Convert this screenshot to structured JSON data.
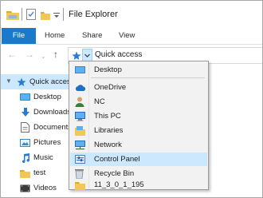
{
  "window": {
    "title": "File Explorer"
  },
  "ribbon": {
    "tabs": [
      "File",
      "Home",
      "Share",
      "View"
    ]
  },
  "address": {
    "path": "Quick access"
  },
  "nav_pane": {
    "quick_access_label": "Quick access",
    "items": [
      {
        "label": "Desktop",
        "icon": "desktop-icon"
      },
      {
        "label": "Downloads",
        "icon": "downloads-icon"
      },
      {
        "label": "Documents",
        "icon": "documents-icon"
      },
      {
        "label": "Pictures",
        "icon": "pictures-icon"
      },
      {
        "label": "Music",
        "icon": "music-icon"
      },
      {
        "label": "test",
        "icon": "folder-icon"
      },
      {
        "label": "Videos",
        "icon": "videos-icon"
      }
    ]
  },
  "dropdown": {
    "items": [
      {
        "label": "Desktop",
        "icon": "desktop-icon"
      },
      {
        "label": "OneDrive",
        "icon": "onedrive-icon"
      },
      {
        "label": "NC",
        "icon": "user-icon"
      },
      {
        "label": "This PC",
        "icon": "this-pc-icon"
      },
      {
        "label": "Libraries",
        "icon": "libraries-icon"
      },
      {
        "label": "Network",
        "icon": "network-icon"
      },
      {
        "label": "Control Panel",
        "icon": "control-panel-icon"
      },
      {
        "label": "Recycle Bin",
        "icon": "recycle-bin-icon"
      },
      {
        "label": "11_3_0_1_195",
        "icon": "folder-icon"
      }
    ],
    "highlighted": "Control Panel"
  },
  "colors": {
    "accent": "#1979ca",
    "selection": "#cce8ff",
    "folder": "#f2c756"
  }
}
